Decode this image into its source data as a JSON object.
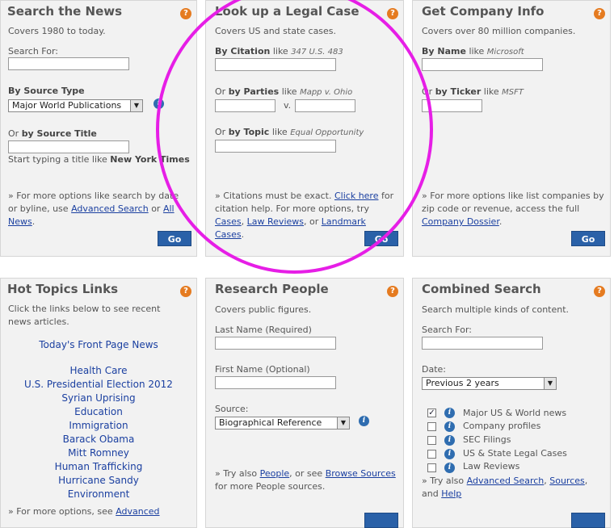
{
  "news": {
    "title": "Search the News",
    "subtitle": "Covers 1980 to today.",
    "search_for_label": "Search For:",
    "source_type_label": "By Source Type",
    "source_type_value": "Major World Publications",
    "source_title_prefix": "Or",
    "source_title_label": "by Source Title",
    "typing_hint_pre": "Start typing a title like",
    "typing_hint_title": "New York Times",
    "note_pre": "» For more options like search by date or byline, use",
    "note_link1": "Advanced Search",
    "note_mid": "or",
    "note_link2": "All News",
    "note_end": ".",
    "go": "Go"
  },
  "legal": {
    "title": "Look up a Legal Case",
    "subtitle": "Covers US and state cases.",
    "citation_label": "By Citation",
    "like": "like",
    "citation_example": "347 U.S. 483",
    "parties_prefix": "Or",
    "parties_label": "by Parties",
    "parties_example": "Mapp v. Ohio",
    "versus": "v.",
    "topic_prefix": "Or",
    "topic_label": "by Topic",
    "topic_example": "Equal Opportunity",
    "note_pre": "» Citations must be exact.",
    "note_link1": "Click here",
    "note_mid": "for citation help. For more options, try",
    "note_link2": "Cases",
    "note_comma": ",",
    "note_link3": "Law Reviews",
    "note_or": ", or",
    "note_link4": "Landmark Cases",
    "note_end": ".",
    "go": "Go"
  },
  "company": {
    "title": "Get Company Info",
    "subtitle": "Covers over 80 million companies.",
    "name_label": "By Name",
    "like": "like",
    "name_example": "Microsoft",
    "ticker_prefix": "Or",
    "ticker_label": "by Ticker",
    "ticker_example": "MSFT",
    "note_pre": "» For more options like list companies by zip code or revenue, access the full",
    "note_link": "Company Dossier",
    "note_end": ".",
    "go": "Go"
  },
  "hot": {
    "title": "Hot Topics Links",
    "subtitle": "Click the links below to see recent news articles.",
    "front_page": "Today's Front Page News",
    "topics": [
      "Health Care",
      "U.S. Presidential Election 2012",
      "Syrian Uprising",
      "Education",
      "Immigration",
      "Barack Obama",
      "Mitt Romney",
      "Human Trafficking",
      "Hurricane Sandy",
      "Environment"
    ],
    "note_pre": "» For more options, see",
    "note_link": "Advanced"
  },
  "people": {
    "title": "Research People",
    "subtitle": "Covers public figures.",
    "last_name_label": "Last Name (Required)",
    "first_name_label": "First Name (Optional)",
    "source_label": "Source:",
    "source_value": "Biographical Reference",
    "note_pre": "» Try also",
    "note_link1": "People",
    "note_mid": ", or see",
    "note_link2": "Browse Sources",
    "note_end": "for more People sources."
  },
  "combined": {
    "title": "Combined Search",
    "subtitle": "Search multiple kinds of content.",
    "search_for_label": "Search For:",
    "date_label": "Date:",
    "date_value": "Previous 2 years",
    "content_types": [
      {
        "label": "Major US & World news",
        "checked": true
      },
      {
        "label": "Company profiles",
        "checked": false
      },
      {
        "label": "SEC Filings",
        "checked": false
      },
      {
        "label": "US & State Legal Cases",
        "checked": false
      },
      {
        "label": "Law Reviews",
        "checked": false
      }
    ],
    "note_pre": "» Try also",
    "note_link1": "Advanced Search",
    "note_comma": ",",
    "note_link2": "Sources",
    "note_mid": ", and",
    "note_link3": "Help"
  },
  "icons": {
    "help": "?",
    "info": "i",
    "dropdown": "▼",
    "check": "✓"
  },
  "colors": {
    "panel_bg": "#f2f2f2",
    "go_button": "#2a61a8",
    "help_icon": "#e57b20",
    "link": "#1a3fa0",
    "annotation_circle": "#e61ee6"
  }
}
